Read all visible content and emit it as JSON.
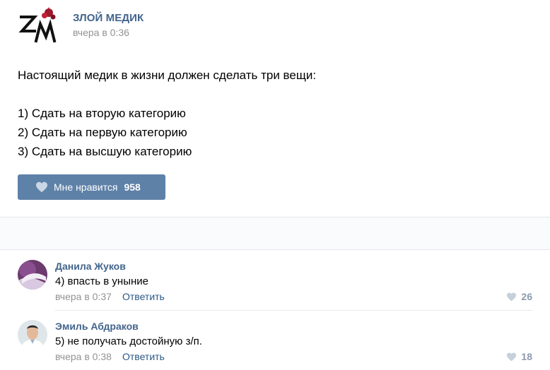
{
  "post": {
    "author": "ЗЛОЙ МЕДИК",
    "time": "вчера в 0:36",
    "text_lines": [
      "Настоящий медик в жизни должен сделать три вещи:",
      "",
      "1) Сдать на вторую категорию",
      "2) Сдать на первую категорию",
      "3) Сдать на высшую категорию"
    ],
    "like_label": "Мне нравится",
    "like_count": "958"
  },
  "comments": [
    {
      "name": "Данила Жуков",
      "text": "4) впасть в уныние",
      "time": "вчера в 0:37",
      "reply_label": "Ответить",
      "likes": "26"
    },
    {
      "name": "Эмиль Абдраков",
      "text": "5) не получать достойную з/п.",
      "time": "вчера в 0:38",
      "reply_label": "Ответить",
      "likes": "18"
    }
  ],
  "colors": {
    "accent": "#42648b",
    "like_button": "#5e81a8",
    "muted": "#939393"
  },
  "icons": [
    "zm-logo",
    "heart-icon",
    "avatar"
  ]
}
